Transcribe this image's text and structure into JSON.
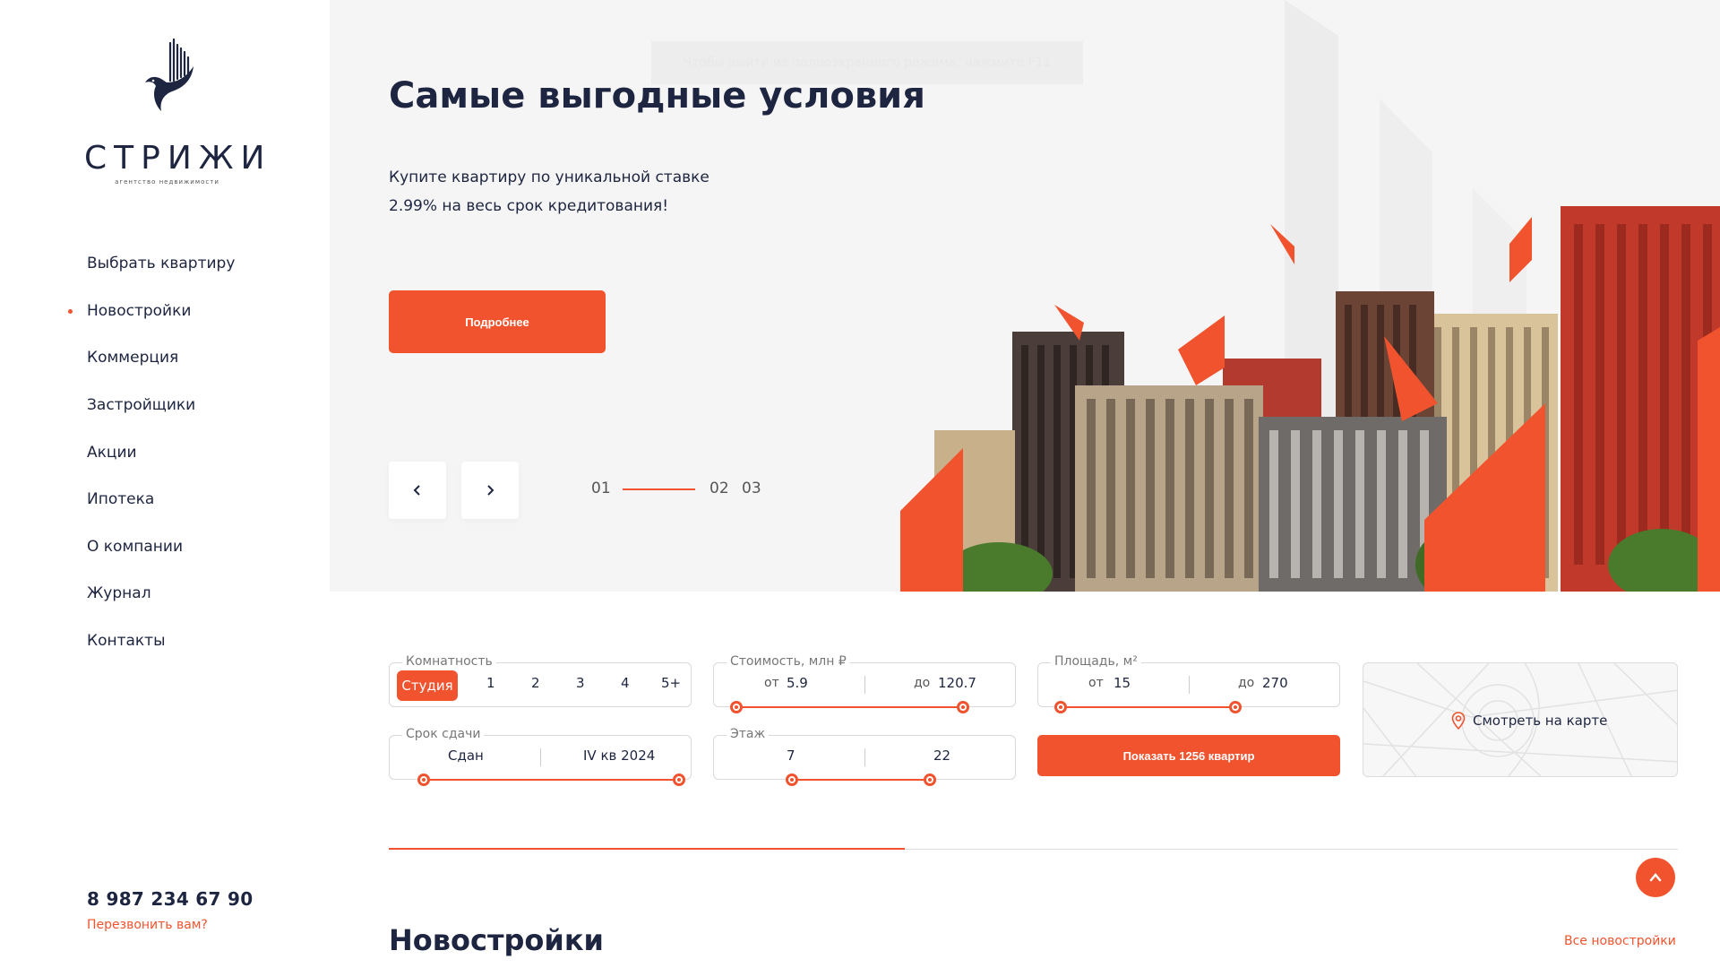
{
  "brand": {
    "name": "СТРИЖИ",
    "tagline": "агентство недвижимости"
  },
  "nav": {
    "items": [
      {
        "label": "Выбрать квартиру"
      },
      {
        "label": "Новостройки",
        "active": true
      },
      {
        "label": "Коммерция"
      },
      {
        "label": "Застройщики"
      },
      {
        "label": "Акции"
      },
      {
        "label": "Ипотека"
      },
      {
        "label": "О компании"
      },
      {
        "label": "Журнал"
      },
      {
        "label": "Контакты"
      }
    ]
  },
  "contact": {
    "phone": "8 987 234 67 90",
    "callback": "Перезвонить вам?"
  },
  "hero": {
    "fullscreen_hint": "Чтобы выйти из полноэкранного режима, нажмите F11",
    "title": "Самые выгодные условия",
    "text_line1": "Купите квартиру по уникальной ставке",
    "text_line2": "2.99% на весь срок кредитования!",
    "button": "Подробнее",
    "slides": [
      "01",
      "02",
      "03"
    ],
    "current_slide": 1
  },
  "filters": {
    "rooms": {
      "label": "Комнатность",
      "options": [
        "Студия",
        "1",
        "2",
        "3",
        "4",
        "5+"
      ],
      "selected": "Студия"
    },
    "price": {
      "label": "Стоимость, млн ₽",
      "from_label": "от",
      "from": "5.9",
      "to_label": "до",
      "to": "120.7"
    },
    "area": {
      "label": "Площадь, м²",
      "from_label": "от",
      "from": "15",
      "to_label": "до",
      "to": "270"
    },
    "deadline": {
      "label": "Срок сдачи",
      "from": "Сдан",
      "to": "IV кв 2024"
    },
    "floor": {
      "label": "Этаж",
      "from": "7",
      "to": "22"
    },
    "show_button": "Показать 1256 квартир",
    "map_button": "Смотреть на карте"
  },
  "section": {
    "title": "Новостройки",
    "link": "Все новостройки"
  },
  "colors": {
    "accent": "#f0532e",
    "text": "#1d2540",
    "hero_bg": "#f5f5f5"
  },
  "icons": {
    "prev": "chevron-left-icon",
    "next": "chevron-right-icon",
    "map_pin": "map-pin-icon",
    "scroll_top": "chevron-up-icon"
  }
}
